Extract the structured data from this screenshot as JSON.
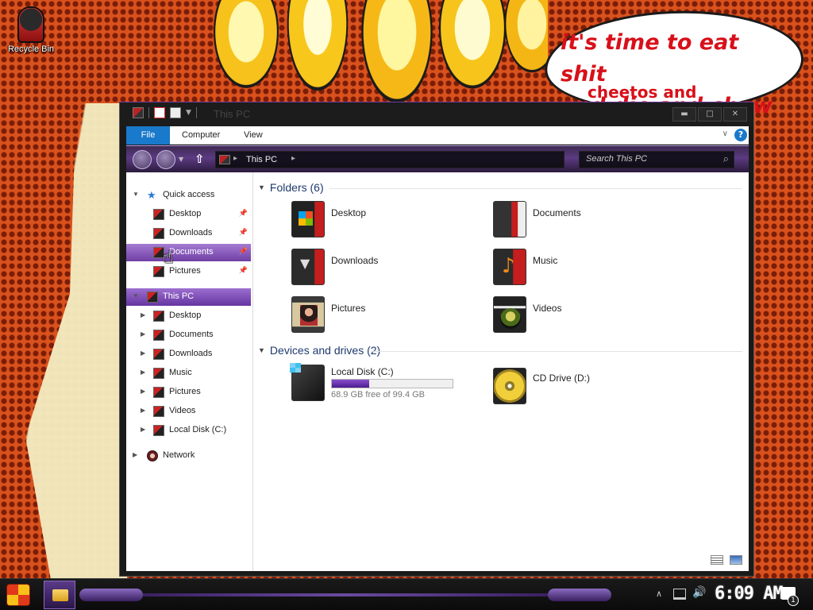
{
  "desktop": {
    "recycle_bin_label": "Recycle Bin",
    "bubble_line1": "it's time to eat shit",
    "bubble_line2": "and die and chew",
    "bubble_line3": "cheetos and"
  },
  "window": {
    "title": "This PC",
    "buttons": {
      "minimize": "▬",
      "maximize": "□",
      "close": "✕"
    }
  },
  "ribbon": {
    "tabs": [
      {
        "label": "File",
        "active": true
      },
      {
        "label": "Computer"
      },
      {
        "label": "View"
      }
    ],
    "help": "?"
  },
  "address": {
    "location": "This PC",
    "search_placeholder": "Search This PC"
  },
  "nav": {
    "quick_access": "Quick access",
    "qa_items": [
      {
        "label": "Desktop",
        "pinned": true
      },
      {
        "label": "Downloads",
        "pinned": true
      },
      {
        "label": "Documents",
        "pinned": true,
        "selected": true
      },
      {
        "label": "Pictures",
        "pinned": true
      }
    ],
    "this_pc": "This PC",
    "pc_items": [
      {
        "label": "Desktop"
      },
      {
        "label": "Documents"
      },
      {
        "label": "Downloads"
      },
      {
        "label": "Music"
      },
      {
        "label": "Pictures"
      },
      {
        "label": "Videos"
      },
      {
        "label": "Local Disk (C:)"
      }
    ],
    "network": "Network"
  },
  "content": {
    "folders_header": "Folders (6)",
    "folders": [
      {
        "name": "Desktop",
        "icon": "desktop-folder-icon"
      },
      {
        "name": "Documents",
        "icon": "documents-folder-icon"
      },
      {
        "name": "Downloads",
        "icon": "downloads-folder-icon"
      },
      {
        "name": "Music",
        "icon": "music-folder-icon"
      },
      {
        "name": "Pictures",
        "icon": "pictures-folder-icon"
      },
      {
        "name": "Videos",
        "icon": "videos-folder-icon"
      }
    ],
    "devices_header": "Devices and drives (2)",
    "drives": [
      {
        "name": "Local Disk (C:)",
        "free": "68.9 GB free of 99.4 GB",
        "used_fraction": 0.307
      },
      {
        "name": "CD Drive (D:)"
      }
    ]
  },
  "taskbar": {
    "clock": "6:09 AM",
    "notification_count": "1"
  },
  "colors": {
    "accent_purple": "#6f3fa4",
    "file_tab_blue": "#1979ca",
    "bubble_text_red": "#d8101a"
  }
}
